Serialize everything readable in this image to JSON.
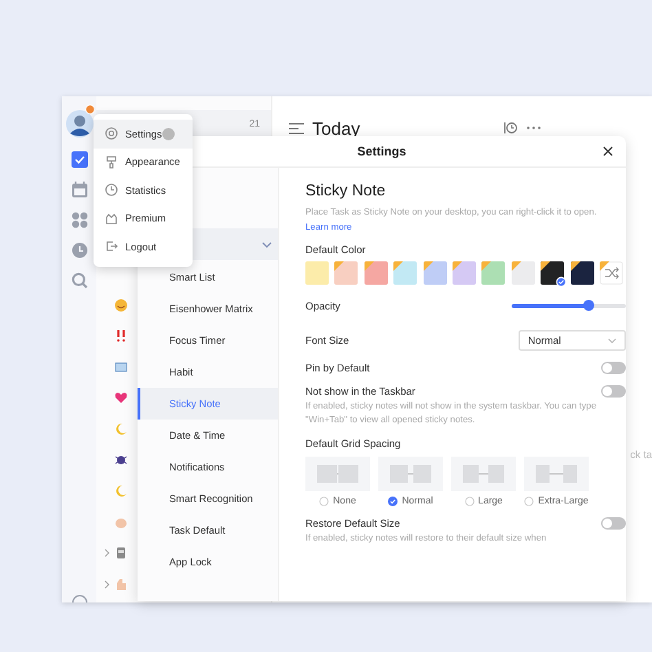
{
  "list_pane": {
    "count": "21"
  },
  "main": {
    "title": "Today",
    "hint": "ck ta"
  },
  "user_menu": {
    "items": [
      {
        "label": "Settings",
        "selected": true
      },
      {
        "label": "Appearance",
        "selected": false
      },
      {
        "label": "Statistics",
        "selected": false
      },
      {
        "label": "Premium",
        "selected": false
      },
      {
        "label": "Logout",
        "selected": false
      }
    ]
  },
  "settings": {
    "title": "Settings",
    "nav_group": {
      "expanded": true
    },
    "nav": [
      {
        "label": "Smart List",
        "selected": false
      },
      {
        "label": "Eisenhower Matrix",
        "selected": false
      },
      {
        "label": "Focus Timer",
        "selected": false
      },
      {
        "label": "Habit",
        "selected": false
      },
      {
        "label": "Sticky Note",
        "selected": true
      },
      {
        "label": "Date & Time",
        "selected": false
      },
      {
        "label": "Notifications",
        "selected": false
      },
      {
        "label": "Smart Recognition",
        "selected": false
      },
      {
        "label": "Task Default",
        "selected": false
      },
      {
        "label": "App Lock",
        "selected": false
      }
    ],
    "section": {
      "title": "Sticky Note",
      "description": "Place Task as Sticky Note on your desktop, you can right-click it to open.",
      "link": "Learn more"
    },
    "default_color": {
      "label": "Default Color",
      "swatches": [
        {
          "kind": "color",
          "color": "#fcecaa",
          "selected": false
        },
        {
          "kind": "color",
          "color": "#f8cfc1",
          "selected": false
        },
        {
          "kind": "color",
          "color": "#f5a7a2",
          "selected": false
        },
        {
          "kind": "color",
          "color": "#c2e9f4",
          "selected": false
        },
        {
          "kind": "color",
          "color": "#bfcdf6",
          "selected": false
        },
        {
          "kind": "color",
          "color": "#d5c9f4",
          "selected": false
        },
        {
          "kind": "color",
          "color": "#acdfb3",
          "selected": false
        },
        {
          "kind": "color",
          "color": "#ececee",
          "selected": false
        },
        {
          "kind": "color",
          "color": "#222324",
          "selected": true
        },
        {
          "kind": "color",
          "color": "#1b2440",
          "selected": false
        },
        {
          "kind": "random",
          "selected": false
        }
      ]
    },
    "opacity": {
      "label": "Opacity",
      "level": 0.67
    },
    "font_size": {
      "label": "Font Size",
      "value": "Normal"
    },
    "pin_by_default": {
      "label": "Pin by Default",
      "on": false
    },
    "hide_taskbar": {
      "label": "Not show in the Taskbar",
      "on": false,
      "description": "If enabled, sticky notes will not show in the system taskbar. You can type \"Win+Tab\" to view all opened sticky notes."
    },
    "grid_spacing": {
      "label": "Default Grid Spacing",
      "options": [
        {
          "label": "None",
          "selected": false
        },
        {
          "label": "Normal",
          "selected": true
        },
        {
          "label": "Large",
          "selected": false
        },
        {
          "label": "Extra-Large",
          "selected": false
        }
      ]
    },
    "restore_size": {
      "label": "Restore Default Size",
      "on": false,
      "description": "If enabled, sticky notes will restore to their default size when"
    }
  }
}
